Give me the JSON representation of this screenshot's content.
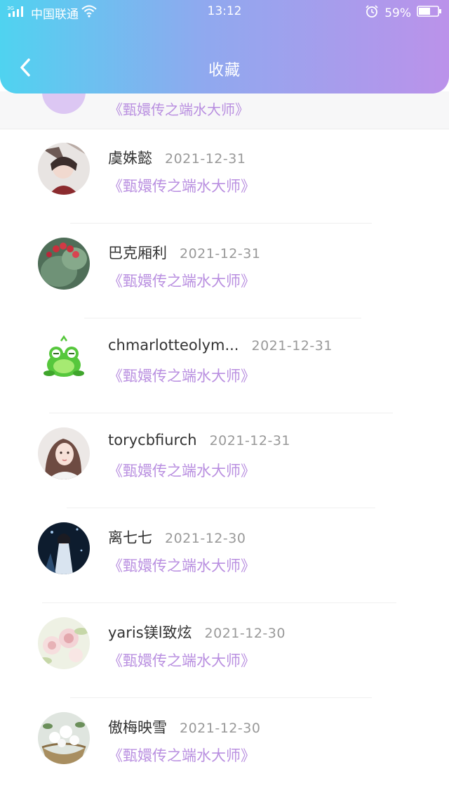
{
  "status_bar": {
    "network": "3G",
    "carrier": "中国联通",
    "time": "13:12",
    "battery": "59%"
  },
  "header": {
    "title": "收藏"
  },
  "list": {
    "partial_title": "《甄嬛传之端水大师》",
    "items": [
      {
        "name": "虞姝懿",
        "date": "2021-12-31",
        "title": "《甄嬛传之端水大师》"
      },
      {
        "name": "巴克厢利",
        "date": "2021-12-31",
        "title": "《甄嬛传之端水大师》"
      },
      {
        "name": "chmarlotteolym...",
        "date": "2021-12-31",
        "title": "《甄嬛传之端水大师》"
      },
      {
        "name": "torycbfiurch",
        "date": "2021-12-31",
        "title": "《甄嬛传之端水大师》"
      },
      {
        "name": "离七七",
        "date": "2021-12-30",
        "title": "《甄嬛传之端水大师》"
      },
      {
        "name": "yaris镁l致炫",
        "date": "2021-12-30",
        "title": "《甄嬛传之端水大师》"
      },
      {
        "name": "傲梅映雪",
        "date": "2021-12-30",
        "title": "《甄嬛传之端水大师》"
      }
    ]
  },
  "colors": {
    "accent": "#b98fe0",
    "header_start": "#4fd3f0",
    "header_end": "#bb92ea"
  }
}
